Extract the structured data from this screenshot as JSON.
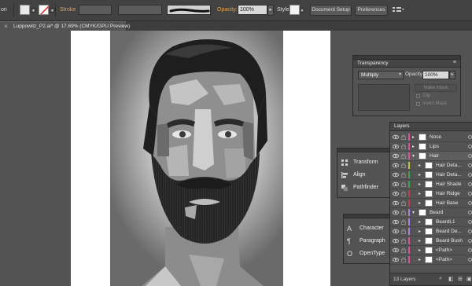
{
  "control_bar": {
    "stroke_label": "Stroke",
    "opacity_label": "Opacity:",
    "opacity_value": "100%",
    "style_label": "Style:",
    "document_setup_label": "Document Setup",
    "preferences_label": "Preferences",
    "clipped_left_label": "on"
  },
  "document": {
    "tab_title": "Luppowitz_P2.ai* @ 17.69% (CMYK/GPU Preview)",
    "close_glyph": "×"
  },
  "transparency_panel": {
    "title": "Transparency",
    "blend_mode": "Multiply",
    "opacity_label": "Opacity:",
    "opacity_value": "100%",
    "make_mask_label": "Make Mask",
    "clip_label": "Clip",
    "invert_mask_label": "Invert Mask"
  },
  "transform_panel": {
    "items": [
      {
        "label": "Transform",
        "icon": "transform-icon"
      },
      {
        "label": "Align",
        "icon": "align-icon"
      },
      {
        "label": "Pathfinder",
        "icon": "pathfinder-icon"
      }
    ]
  },
  "character_panel": {
    "items": [
      {
        "label": "Character",
        "icon": "character-icon"
      },
      {
        "label": "Paragraph",
        "icon": "paragraph-icon"
      },
      {
        "label": "OpenType",
        "icon": "opentype-icon"
      }
    ]
  },
  "layers_panel": {
    "title": "Layers",
    "footer_count": "13 Layers",
    "rows": [
      {
        "name": "Nose",
        "expanded": false,
        "color": "#e0509a",
        "level": 1
      },
      {
        "name": "Lips",
        "expanded": false,
        "color": "#e0509a",
        "level": 1
      },
      {
        "name": "Hair",
        "expanded": true,
        "color": "#e0509a",
        "level": 1
      },
      {
        "name": "Hair Deta...",
        "expanded": false,
        "color": "#c8c040",
        "level": 2
      },
      {
        "name": "Hair Deta...",
        "expanded": false,
        "color": "#3fa34a",
        "level": 2
      },
      {
        "name": "Hair Shade",
        "expanded": false,
        "color": "#3fa34a",
        "level": 2
      },
      {
        "name": "Hair Ridge",
        "expanded": false,
        "color": "#c04050",
        "level": 2
      },
      {
        "name": "Hair Base",
        "expanded": false,
        "color": "#c04050",
        "level": 2
      },
      {
        "name": "Beard",
        "expanded": true,
        "color": "#b07de0",
        "level": 1
      },
      {
        "name": "BeardL1",
        "expanded": false,
        "color": "#b07de0",
        "level": 2
      },
      {
        "name": "Beard De...",
        "expanded": false,
        "color": "#b07de0",
        "level": 2
      },
      {
        "name": "Beard Bush",
        "expanded": false,
        "color": "#e0509a",
        "level": 2
      },
      {
        "name": "<Path>",
        "expanded": false,
        "color": "#e0509a",
        "level": 2
      },
      {
        "name": "<Path>",
        "expanded": false,
        "color": "#e0509a",
        "level": 2
      }
    ]
  }
}
